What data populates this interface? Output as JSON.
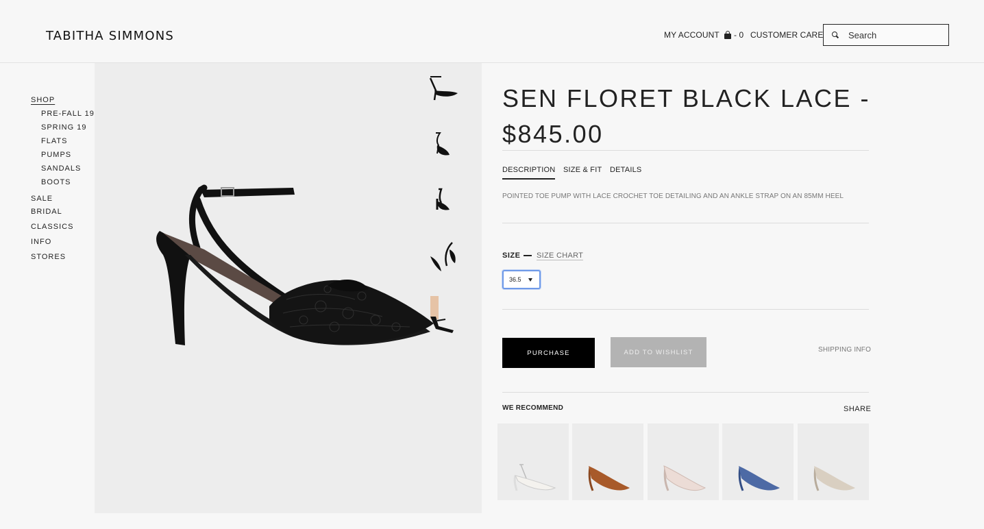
{
  "header": {
    "logo": "TABITHA SIMMONS",
    "my_account": "MY ACCOUNT",
    "cart_count": "- 0",
    "customer_care": "CUSTOMER CARE",
    "search_placeholder": "Search"
  },
  "sidebar": {
    "shop": "SHOP",
    "shop_items": [
      "PRE-FALL 19",
      "SPRING 19",
      "FLATS",
      "PUMPS",
      "SANDALS",
      "BOOTS"
    ],
    "items": [
      "SALE",
      "BRIDAL",
      "CLASSICS",
      "INFO",
      "STORES"
    ]
  },
  "product": {
    "title": "SEN FLORET BLACK LACE - $845.00",
    "tabs": [
      "DESCRIPTION",
      "SIZE & FIT",
      "DETAILS"
    ],
    "description": "POINTED TOE PUMP WITH LACE CROCHET TOE DETAILING AND AN ANKLE STRAP ON AN 85MM HEEL",
    "size_label": "SIZE",
    "size_chart": "SIZE CHART",
    "size_value": "36.5",
    "purchase": "PURCHASE",
    "wishlist": "ADD TO WISHLIST",
    "shipping_info": "SHIPPING INFO"
  },
  "recommend": {
    "title": "WE RECOMMEND",
    "share": "SHARE",
    "colors": [
      "#f2f0ec",
      "#a85a2a",
      "#ecdcd6",
      "#4d6aa5",
      "#d9cfc1"
    ]
  },
  "colors": {
    "accent_focus": "#6f9ae8",
    "button_dark": "#000000",
    "button_disabled": "#b3b3b3"
  }
}
